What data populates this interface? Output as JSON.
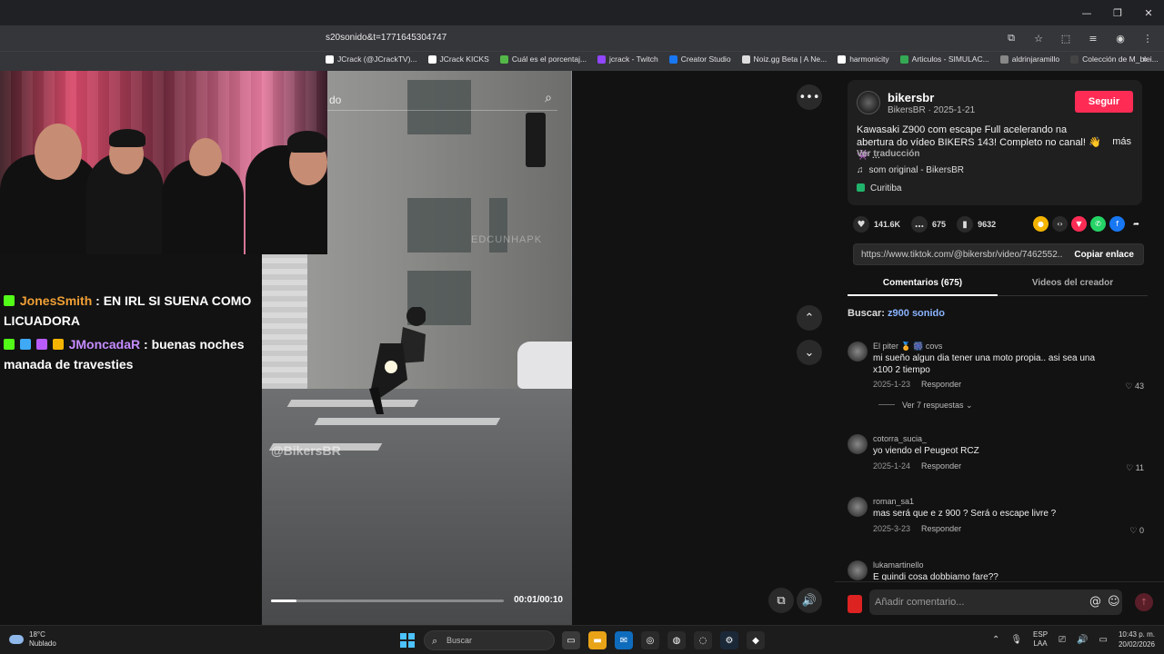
{
  "browser": {
    "url": "s20sonido&t=1771645304747",
    "bookmarks": [
      {
        "label": "JCrack (@JCrackTV)...",
        "color": "#ffffff"
      },
      {
        "label": "JCrack KICKS",
        "color": "#ffffff"
      },
      {
        "label": "Cuál es el porcentaj...",
        "color": "#53b848"
      },
      {
        "label": "jcrack - Twitch",
        "color": "#9146ff"
      },
      {
        "label": "Creator Studio",
        "color": "#1877f2"
      },
      {
        "label": "Noiz.gg Beta | A Ne...",
        "color": "#dddddd"
      },
      {
        "label": "harmonicity",
        "color": "#ffffff"
      },
      {
        "label": "Articulos - SIMULAC...",
        "color": "#34a853"
      },
      {
        "label": "aldrinjaramillo",
        "color": "#888888"
      },
      {
        "label": "Colección de M_blei...",
        "color": "#444444"
      }
    ],
    "more": "»",
    "window_controls": [
      "—",
      "❐",
      "✕"
    ]
  },
  "chat": {
    "messages": [
      {
        "user": "JonesSmith",
        "text": ": EN IRL SI SUENA COMO LICUADORA"
      },
      {
        "user": "JMoncadaR",
        "text": ": buenas noches manada de travesties"
      }
    ]
  },
  "video": {
    "search_query": "do",
    "watermark": "@BikersBR",
    "watermark_channel": "EDCUNHAPK",
    "time": "00:01/00:10",
    "progress": 0.11
  },
  "post": {
    "author": "bikersbr",
    "author_sub": "BikersBR · 2025-1-21",
    "follow_label": "Seguir",
    "description": "Kawasaki Z900 com escape Full acelerando na abertura do vídeo BIKERS 143! Completo no canal! 👋 👾 ...",
    "more_label": "más",
    "translate_label": "Ver traducción",
    "sound": "som original - BikersBR",
    "location": "Curitiba",
    "likes": "141.6K",
    "comments_count": "675",
    "saves": "9632",
    "link": "https://www.tiktok.com/@bikersbr/video/7462552...",
    "copy_label": "Copiar enlace",
    "tab_comments": "Comentarios (675)",
    "tab_videos": "Videos del creador",
    "search_prefix": "Buscar:",
    "search_keyword": "z900 sonido"
  },
  "comments": [
    {
      "name": "El piter 🏅 🎆 covs",
      "text": "mi sueño algun dia tener una moto propia.. asi sea una x100 2 tiempo",
      "date": "2025-1-23",
      "reply": "Responder",
      "likes": "43",
      "replies": "Ver 7 respuestas ⌄"
    },
    {
      "name": "cotorra_sucia_",
      "text": "yo viendo el Peugeot RCZ",
      "date": "2025-1-24",
      "reply": "Responder",
      "likes": "11"
    },
    {
      "name": "roman_sa1",
      "text": "mas será que e z 900 ? Será o escape livre ?",
      "date": "2025-3-23",
      "reply": "Responder",
      "likes": "0"
    },
    {
      "name": "lukamartinello",
      "text": "E quindi cosa dobbiamo fare??"
    }
  ],
  "comment_input": {
    "placeholder": "Añadir comentario..."
  },
  "taskbar": {
    "temp": "18°C",
    "weather": "Nublado",
    "search": "Buscar",
    "lang": "ESP",
    "layout": "LAA",
    "time": "10:43 p. m.",
    "date": "20/02/2026"
  }
}
